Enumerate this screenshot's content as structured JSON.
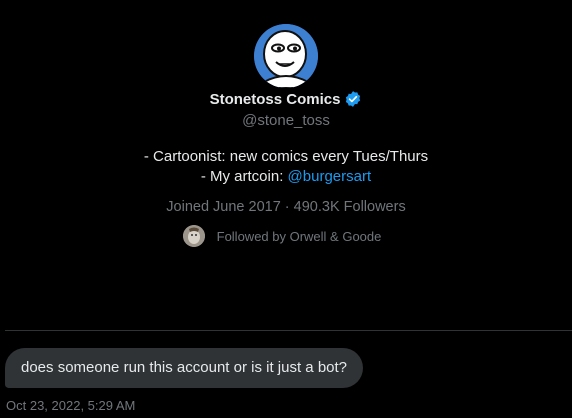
{
  "profile": {
    "display_name": "Stonetoss Comics",
    "handle": "@stone_toss",
    "verified_badge_icon": "verified-badge-icon",
    "bio_line1": "- Cartoonist: new comics every Tues/Thurs",
    "bio_line2_prefix": "- My artcoin: ",
    "bio_line2_link": "@burgersart",
    "joined": "Joined June 2017",
    "separator": " · ",
    "followers": "490.3K Followers",
    "followed_by": "Followed by Orwell & Goode"
  },
  "message": {
    "text": "does someone run this account or is it just a bot?",
    "timestamp": "Oct 23, 2022, 5:29 AM"
  },
  "colors": {
    "background": "#000000",
    "accent": "#1d9bf0",
    "muted": "#71767b",
    "bubble": "#2f3336"
  }
}
